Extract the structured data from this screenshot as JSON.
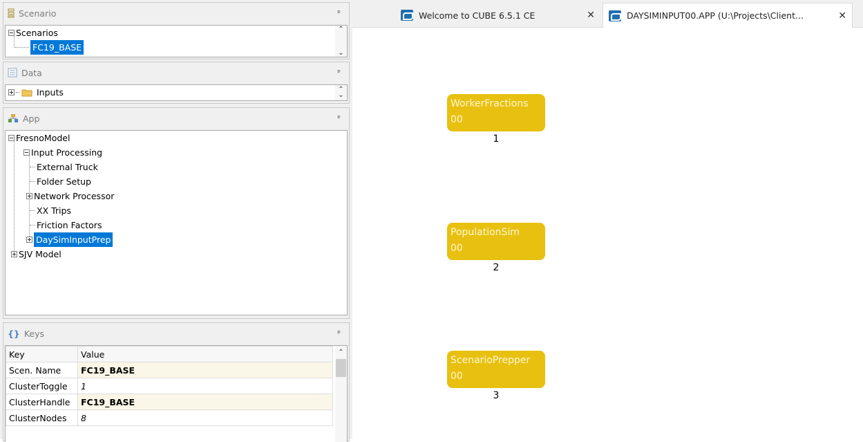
{
  "scenario_panel": {
    "title": "Scenario",
    "pin": "ᵖ",
    "tree": {
      "root": "Scenarios",
      "child": "FC19_BASE"
    }
  },
  "data_panel": {
    "title": "Data",
    "pin": "ᵖ",
    "tree": {
      "root": "Inputs"
    }
  },
  "app_panel": {
    "title": "App",
    "pin": "ᵖ",
    "tree": {
      "root": "FresnoModel",
      "input_processing": "Input Processing",
      "external_truck": "External Truck",
      "folder_setup": "Folder Setup",
      "network_processor": "Network Processor",
      "xx_trips": "XX Trips",
      "friction_factors": "Friction Factors",
      "daysim_input_prep": "DaySimInputPrep",
      "sjv_model": "SJV Model"
    }
  },
  "keys_panel": {
    "title": "Keys",
    "pin": "ᵖ",
    "headers": {
      "key": "Key",
      "value": "Value"
    },
    "rows": [
      {
        "key": "Scen. Name",
        "value": "FC19_BASE"
      },
      {
        "key": "ClusterToggle",
        "value": "1"
      },
      {
        "key": "ClusterHandle",
        "value": "FC19_BASE"
      },
      {
        "key": "ClusterNodes",
        "value": "8"
      }
    ]
  },
  "tabs": [
    {
      "label": "Welcome to CUBE 6.5.1 CE",
      "close": "✕"
    },
    {
      "label": "DAYSIMINPUT00.APP (U:\\Projects\\Client...",
      "close": "✕"
    }
  ],
  "nodes": [
    {
      "name": "WorkerFractions",
      "code": "00",
      "number": "1"
    },
    {
      "name": "PopulationSim",
      "code": "00",
      "number": "2"
    },
    {
      "name": "ScenarioPrepper",
      "code": "00",
      "number": "3"
    }
  ],
  "colors": {
    "node_fill": "#e8c010",
    "selection": "#0078d7"
  }
}
